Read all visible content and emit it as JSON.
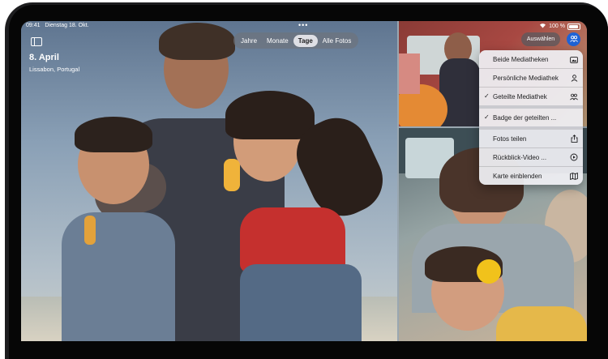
{
  "status_bar": {
    "time": "09:41",
    "date": "Dienstag 18. Okt.",
    "battery": "100 %"
  },
  "header": {
    "date_title": "8. April",
    "location": "Lissabon, Portugal"
  },
  "view_tabs": [
    {
      "label": "Jahre",
      "active": false
    },
    {
      "label": "Monate",
      "active": false
    },
    {
      "label": "Tage",
      "active": true
    },
    {
      "label": "Alle Fotos",
      "active": false
    }
  ],
  "toolbar": {
    "select_label": "Auswählen"
  },
  "library_menu": {
    "items": [
      {
        "label": "Beide Mediatheken",
        "checked": false,
        "icon": "photo-stack-icon"
      },
      {
        "label": "Persönliche Mediathek",
        "checked": false,
        "icon": "person-icon"
      },
      {
        "label": "Geteilte Mediathek",
        "checked": true,
        "icon": "two-people-icon"
      },
      {
        "label": "Badge der geteilten ...",
        "checked": true,
        "icon": ""
      },
      {
        "label": "Fotos teilen",
        "checked": false,
        "icon": "share-icon"
      },
      {
        "label": "Rückblick-Video ...",
        "checked": false,
        "icon": "memories-icon"
      },
      {
        "label": "Karte einblenden",
        "checked": false,
        "icon": "map-icon"
      }
    ]
  },
  "colors": {
    "accent": "#1f63d6",
    "menu_background": "#eeeef2"
  }
}
